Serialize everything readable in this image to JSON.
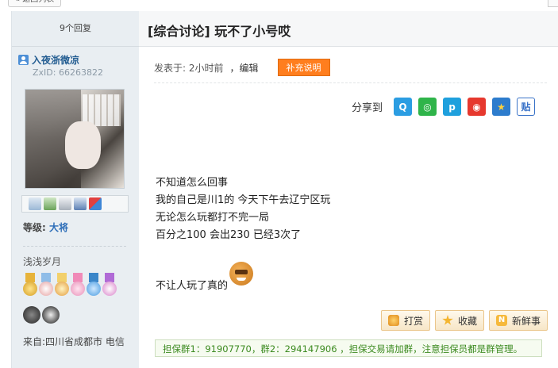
{
  "nav": {
    "back_label": "« 返回列表"
  },
  "sidebar": {
    "reply_count": "9个回复",
    "username": "入夜浙微凉",
    "zxid": "ZxID: 66263822",
    "level_label": "等级:",
    "level_value": "大将",
    "motto": "浅浅岁月",
    "location": "来自:四川省成都市 电信"
  },
  "post": {
    "title": "[综合讨论] 玩不了小号哎",
    "posted_label": "发表于: 2小时前",
    "edit_label": "，编辑",
    "supplement_button": "补充说明",
    "share_label": "分享到",
    "share_icons": [
      "qq-icon",
      "wechat-icon",
      "qzone-icon",
      "weibo-icon",
      "star-icon",
      "tieba-icon"
    ],
    "lines": [
      "不知道怎么回事",
      "我的自己是川1的 今天下午去辽宁区玩",
      "无论怎么玩都打不完一局",
      "百分之100 会出230  已经3次了"
    ],
    "last_line": "不让人玩了真的",
    "buttons": {
      "reward": "打赏",
      "favorite": "收藏",
      "fresh": "新鲜事"
    },
    "notice": "担保群1：91907770，群2：294147906 ，担保交易请加群，注意担保员都是群管理。"
  },
  "colors": {
    "accent_orange": "#ff7e1e",
    "link_blue": "#2c6db8",
    "notice_green": "#3b8a1f"
  }
}
